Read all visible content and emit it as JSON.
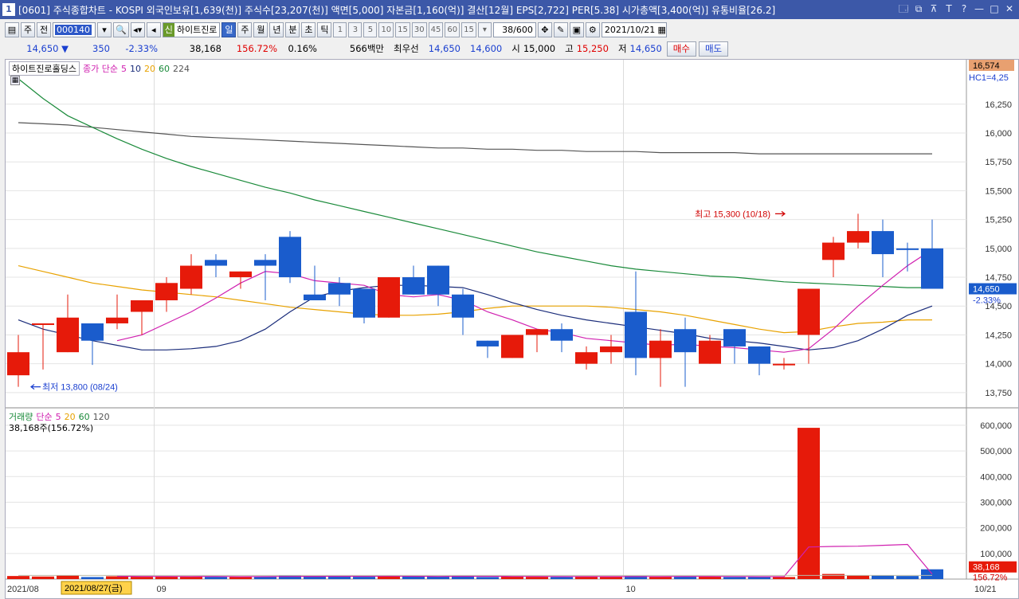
{
  "title_bar": {
    "window_number": "1",
    "title": "[0601] 주식종합차트 - KOSPI 외국인보유[1,639(천)] 주식수[23,207(천)] 액면[5,000] 자본금[1,160(억)] 결산[12월] EPS[2,722] PER[5.38] 시가총액[3,400(억)] 유통비율[26.2]",
    "buttons": [
      "🗔",
      "⧉",
      "⊼",
      "T",
      "?",
      "—",
      "□",
      "✕"
    ]
  },
  "toolbar": {
    "market": "주",
    "all": "전",
    "code": "000140",
    "name_tag": "신",
    "name": "하이트진로",
    "periods": [
      "일",
      "주",
      "월",
      "년",
      "분",
      "초",
      "틱"
    ],
    "selected_period": "일",
    "intervals": [
      "1",
      "3",
      "5",
      "10",
      "15",
      "30",
      "45",
      "60",
      "15"
    ],
    "count": "38/600",
    "date": "2021/10/21"
  },
  "quote": {
    "price": "14,650 ▼",
    "change": "350",
    "change_pct": "-2.33%",
    "volume": "38,168",
    "volume_ratio": "156.72%",
    "turnover": "0.16%",
    "amount": "566백만",
    "best_label": "최우선",
    "ask": "14,650",
    "bid": "14,600",
    "open_label": "시",
    "open": "15,000",
    "high_label": "고",
    "high": "15,250",
    "low_label": "저",
    "low": "14,650",
    "buy_button": "매수",
    "sell_button": "매도"
  },
  "price_panel": {
    "legend": {
      "name": "하이트진로홀딩스",
      "label": "종가 단순",
      "ma": [
        "5",
        "10",
        "20",
        "60",
        "224"
      ]
    },
    "top_value": "16,574",
    "hc_label": "HC1=4,25",
    "current": "14,650",
    "current_pct": "-2.33%",
    "high_annotation": "최고 15,300 (10/18)",
    "low_annotation": "최저 13,800 (08/24)"
  },
  "volume_panel": {
    "legend": {
      "name": "거래량",
      "label": "단순",
      "ma": [
        "5",
        "20",
        "60",
        "120"
      ]
    },
    "info": "38,168주(156.72%)",
    "current": "38,168",
    "current_pct": "156.72%"
  },
  "x_axis": {
    "labels": [
      "2021/08",
      "09",
      "10",
      "10/21"
    ],
    "cursor_label": "2021/08/27(금)"
  },
  "colors": {
    "up": "#e61a0a",
    "down": "#1a5ccc",
    "ma5": "#d020b0",
    "ma10": "#1a2c7a",
    "ma20": "#e8a200",
    "ma60": "#1a8a3a",
    "ma224": "#555555"
  },
  "chart_data": [
    {
      "type": "candlestick",
      "y_ticks": [
        13750,
        14000,
        14250,
        14500,
        14750,
        15000,
        15250,
        15500,
        15750,
        16000,
        16250
      ],
      "y_tick_labels": [
        "13,750",
        "14,000",
        "14,250",
        "14,500",
        "14,750",
        "15,000",
        "15,250",
        "15,500",
        "15,750",
        "16,000",
        "16,250"
      ],
      "ylim": [
        13680,
        16580
      ],
      "candles": [
        {
          "o": 13900,
          "h": 14250,
          "l": 13800,
          "c": 14100
        },
        {
          "o": 14350,
          "h": 14350,
          "l": 13950,
          "c": 14350
        },
        {
          "o": 14100,
          "h": 14600,
          "l": 14100,
          "c": 14400
        },
        {
          "o": 14350,
          "h": 14350,
          "l": 13990,
          "c": 14200
        },
        {
          "o": 14350,
          "h": 14600,
          "l": 14300,
          "c": 14400
        },
        {
          "o": 14450,
          "h": 14550,
          "l": 14250,
          "c": 14550
        },
        {
          "o": 14550,
          "h": 14750,
          "l": 14450,
          "c": 14700
        },
        {
          "o": 14650,
          "h": 14950,
          "l": 14600,
          "c": 14850
        },
        {
          "o": 14900,
          "h": 14950,
          "l": 14750,
          "c": 14850
        },
        {
          "o": 14750,
          "h": 14800,
          "l": 14650,
          "c": 14800
        },
        {
          "o": 14900,
          "h": 14950,
          "l": 14550,
          "c": 14850
        },
        {
          "o": 15100,
          "h": 15150,
          "l": 14700,
          "c": 14750
        },
        {
          "o": 14600,
          "h": 14850,
          "l": 14550,
          "c": 14550
        },
        {
          "o": 14700,
          "h": 14750,
          "l": 14500,
          "c": 14600
        },
        {
          "o": 14650,
          "h": 14650,
          "l": 14350,
          "c": 14400
        },
        {
          "o": 14400,
          "h": 14750,
          "l": 14400,
          "c": 14750
        },
        {
          "o": 14750,
          "h": 14850,
          "l": 14600,
          "c": 14600
        },
        {
          "o": 14850,
          "h": 14850,
          "l": 14500,
          "c": 14600
        },
        {
          "o": 14600,
          "h": 14650,
          "l": 14250,
          "c": 14400
        },
        {
          "o": 14200,
          "h": 14200,
          "l": 14050,
          "c": 14150
        },
        {
          "o": 14050,
          "h": 14250,
          "l": 14050,
          "c": 14250
        },
        {
          "o": 14250,
          "h": 14300,
          "l": 14100,
          "c": 14300
        },
        {
          "o": 14300,
          "h": 14350,
          "l": 14100,
          "c": 14200
        },
        {
          "o": 14000,
          "h": 14150,
          "l": 13950,
          "c": 14100
        },
        {
          "o": 14100,
          "h": 14250,
          "l": 14000,
          "c": 14150
        },
        {
          "o": 14450,
          "h": 14800,
          "l": 13900,
          "c": 14050
        },
        {
          "o": 14050,
          "h": 14300,
          "l": 13800,
          "c": 14200
        },
        {
          "o": 14300,
          "h": 14400,
          "l": 13800,
          "c": 14100
        },
        {
          "o": 14000,
          "h": 14250,
          "l": 14000,
          "c": 14200
        },
        {
          "o": 14300,
          "h": 14300,
          "l": 14000,
          "c": 14150
        },
        {
          "o": 14150,
          "h": 14150,
          "l": 13900,
          "c": 14000
        },
        {
          "o": 14000,
          "h": 14050,
          "l": 13950,
          "c": 14000
        },
        {
          "o": 14250,
          "h": 14250,
          "l": 14000,
          "c": 14650
        },
        {
          "o": 14900,
          "h": 15100,
          "l": 14750,
          "c": 15050
        },
        {
          "o": 15050,
          "h": 15300,
          "l": 15000,
          "c": 15150
        },
        {
          "o": 15150,
          "h": 15250,
          "l": 14750,
          "c": 14950
        },
        {
          "o": 15000,
          "h": 15050,
          "l": 14800,
          "c": 14990
        },
        {
          "o": 15000,
          "h": 15250,
          "l": 14650,
          "c": 14650
        }
      ],
      "ma5": [
        null,
        null,
        null,
        null,
        14200,
        14250,
        14350,
        14450,
        14570,
        14700,
        14800,
        14780,
        14720,
        14700,
        14680,
        14600,
        14580,
        14600,
        14550,
        14450,
        14380,
        14300,
        14270,
        14220,
        14200,
        14180,
        14160,
        14170,
        14150,
        14140,
        14120,
        14100,
        14130,
        14300,
        14500,
        14680,
        14850,
        14990
      ],
      "ma10": [
        14380,
        14300,
        14250,
        14200,
        14160,
        14120,
        14120,
        14130,
        14150,
        14200,
        14300,
        14450,
        14580,
        14630,
        14660,
        14680,
        14680,
        14670,
        14660,
        14600,
        14530,
        14470,
        14420,
        14380,
        14350,
        14320,
        14290,
        14260,
        14220,
        14200,
        14180,
        14150,
        14120,
        14140,
        14200,
        14300,
        14420,
        14500
      ],
      "ma20": [
        14850,
        14800,
        14750,
        14700,
        14670,
        14640,
        14620,
        14600,
        14580,
        14550,
        14520,
        14490,
        14470,
        14450,
        14430,
        14420,
        14420,
        14430,
        14450,
        14480,
        14500,
        14500,
        14500,
        14500,
        14490,
        14470,
        14450,
        14420,
        14380,
        14340,
        14300,
        14270,
        14280,
        14320,
        14350,
        14360,
        14380,
        14380
      ],
      "ma60": [
        16470,
        16300,
        16150,
        16050,
        15950,
        15860,
        15780,
        15710,
        15650,
        15590,
        15530,
        15480,
        15420,
        15370,
        15320,
        15270,
        15220,
        15170,
        15120,
        15070,
        15020,
        14970,
        14930,
        14890,
        14850,
        14820,
        14800,
        14780,
        14760,
        14750,
        14730,
        14710,
        14700,
        14690,
        14680,
        14670,
        14660,
        14660
      ],
      "ma224": [
        16090,
        16080,
        16070,
        16050,
        16030,
        16010,
        15990,
        15970,
        15960,
        15950,
        15940,
        15930,
        15920,
        15910,
        15900,
        15890,
        15880,
        15870,
        15870,
        15860,
        15860,
        15850,
        15850,
        15840,
        15840,
        15840,
        15830,
        15830,
        15830,
        15830,
        15820,
        15820,
        15820,
        15820,
        15820,
        15820,
        15820,
        15820
      ]
    },
    {
      "type": "bar",
      "title": "거래량",
      "y_ticks": [
        100000,
        200000,
        300000,
        400000,
        500000,
        600000
      ],
      "y_tick_labels": [
        "100,000",
        "200,000",
        "300,000",
        "400,000",
        "500,000",
        "600,000"
      ],
      "ylim": [
        0,
        640000
      ],
      "values": [
        12000,
        10000,
        14000,
        8000,
        11000,
        9000,
        10000,
        11000,
        9000,
        8000,
        10000,
        14000,
        12000,
        10000,
        9000,
        12000,
        11000,
        10000,
        13000,
        8000,
        10000,
        9000,
        8000,
        11000,
        10000,
        12000,
        9000,
        11000,
        10000,
        8000,
        9000,
        8000,
        590000,
        20000,
        15000,
        14000,
        12000,
        38168
      ],
      "ma5_values": [
        null,
        null,
        null,
        null,
        11000,
        10400,
        10400,
        9800,
        10200,
        9400,
        9600,
        10400,
        10600,
        10800,
        11000,
        11400,
        10800,
        10400,
        11000,
        10800,
        10400,
        10200,
        9600,
        9800,
        9600,
        10000,
        9600,
        10200,
        10400,
        10000,
        9400,
        9200,
        125200,
        127400,
        128400,
        131800,
        135000,
        19834
      ]
    }
  ]
}
